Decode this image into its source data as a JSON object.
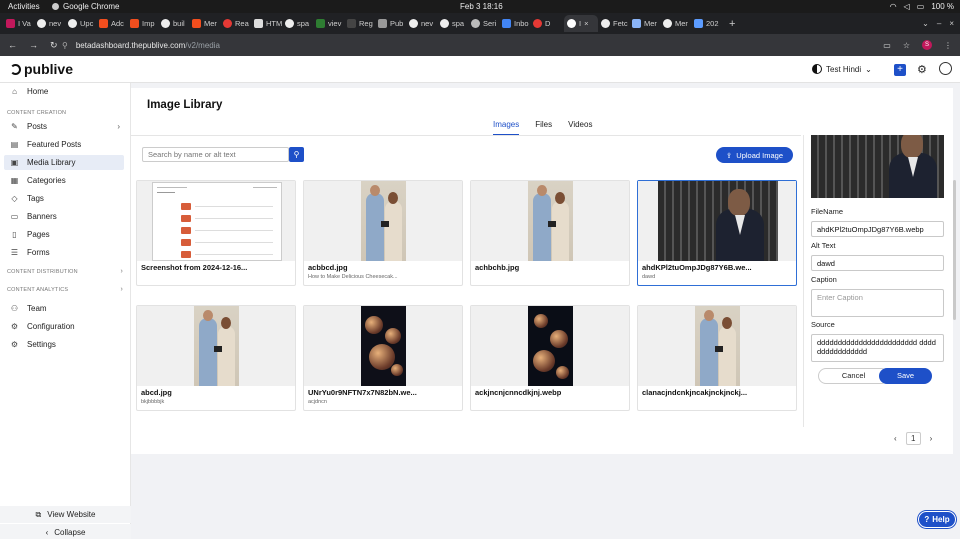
{
  "os": {
    "activities": "Activities",
    "app": "Google Chrome",
    "clock": "Feb 3  18:16",
    "battery": "100 %"
  },
  "browser": {
    "tabs": [
      {
        "label": "I Va"
      },
      {
        "label": "nev"
      },
      {
        "label": "Upc"
      },
      {
        "label": "Adc"
      },
      {
        "label": "Imp"
      },
      {
        "label": "buil"
      },
      {
        "label": "Mer"
      },
      {
        "label": "Rea"
      },
      {
        "label": "HTM"
      },
      {
        "label": "spa"
      },
      {
        "label": "viev"
      },
      {
        "label": "Reg"
      },
      {
        "label": "Pub"
      },
      {
        "label": "nev"
      },
      {
        "label": "spa"
      },
      {
        "label": "Seri"
      },
      {
        "label": "Inbo"
      },
      {
        "label": "D"
      },
      {
        "label": "I"
      },
      {
        "label": "Fetc"
      },
      {
        "label": "Mer"
      },
      {
        "label": "Mer"
      },
      {
        "label": "202"
      }
    ],
    "url_host": "betadashboard.thepublive.com",
    "url_path": "/v2/media",
    "profile_initial": "S"
  },
  "header": {
    "logo": "publive",
    "workspace": "Test Hindi"
  },
  "sidebar": {
    "items": [
      {
        "label": "Home"
      },
      {
        "label": "Posts"
      },
      {
        "label": "Featured Posts"
      },
      {
        "label": "Media Library"
      },
      {
        "label": "Categories"
      },
      {
        "label": "Tags"
      },
      {
        "label": "Banners"
      },
      {
        "label": "Pages"
      },
      {
        "label": "Forms"
      },
      {
        "label": "Team"
      },
      {
        "label": "Configuration"
      },
      {
        "label": "Settings"
      }
    ],
    "sections": {
      "creation": "CONTENT CREATION",
      "distribution": "CONTENT DISTRIBUTION",
      "analytics": "CONTENT ANALYTICS"
    },
    "view_website": "View Website",
    "collapse": "Collapse"
  },
  "library": {
    "title": "Image Library",
    "tabs": [
      {
        "label": "Images"
      },
      {
        "label": "Files"
      },
      {
        "label": "Videos"
      }
    ],
    "search_placeholder": "Search by name or alt text",
    "upload_label": "Upload Image",
    "cards": [
      {
        "name": "Screenshot from 2024-12-16...",
        "sub": ""
      },
      {
        "name": "acbbcd.jpg",
        "sub": "How to Make Delicious Cheesecak..."
      },
      {
        "name": "achbchb.jpg",
        "sub": ""
      },
      {
        "name": "ahdKPl2tuOmpJDg87Y6B.we...",
        "sub": "dawd"
      },
      {
        "name": "abcd.jpg",
        "sub": "bkjbbbbjk"
      },
      {
        "name": "UNrYu0r9NFTN7x7N82bN.we...",
        "sub": "acjdncn"
      },
      {
        "name": "ackjncnjcnncdkjnj.webp",
        "sub": ""
      },
      {
        "name": "clanacjndcnkjncakjnckjnckj...",
        "sub": ""
      }
    ]
  },
  "details": {
    "filename_label": "FileName",
    "filename_value": "ahdKPl2tuOmpJDg87Y6B.webp",
    "alt_label": "Alt Text",
    "alt_value": "dawd",
    "caption_label": "Caption",
    "caption_placeholder": "Enter Caption",
    "source_label": "Source",
    "source_value": "dddddddddddddddddddddddd dddddddddddddddd",
    "cancel": "Cancel",
    "save": "Save"
  },
  "pager": {
    "page": "1"
  },
  "help": "Help"
}
